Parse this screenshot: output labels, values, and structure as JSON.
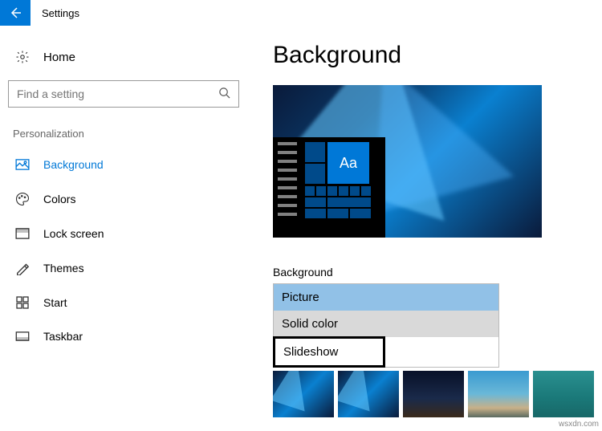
{
  "header": {
    "app_title": "Settings"
  },
  "sidebar": {
    "home_label": "Home",
    "search_placeholder": "Find a setting",
    "section_title": "Personalization",
    "items": [
      {
        "label": "Background",
        "icon": "picture-icon",
        "active": true
      },
      {
        "label": "Colors",
        "icon": "palette-icon",
        "active": false
      },
      {
        "label": "Lock screen",
        "icon": "lock-screen-icon",
        "active": false
      },
      {
        "label": "Themes",
        "icon": "themes-icon",
        "active": false
      },
      {
        "label": "Start",
        "icon": "start-icon",
        "active": false
      },
      {
        "label": "Taskbar",
        "icon": "taskbar-icon",
        "active": false
      }
    ]
  },
  "content": {
    "page_title": "Background",
    "preview_tile_text": "Aa",
    "dropdown_label": "Background",
    "dropdown_options": [
      "Picture",
      "Solid color",
      "Slideshow"
    ]
  },
  "watermark": "wsxdn.com"
}
